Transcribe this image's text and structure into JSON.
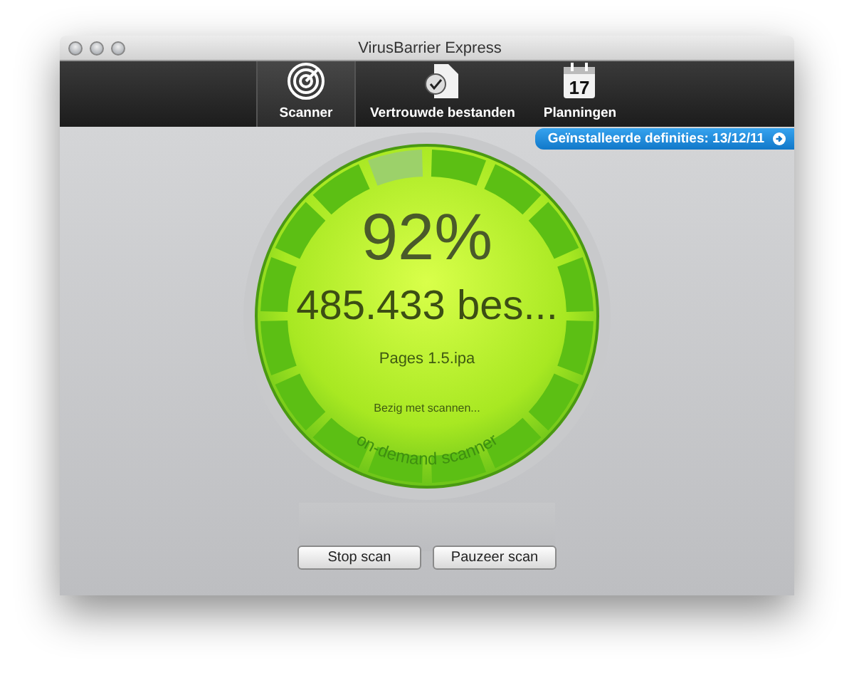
{
  "window": {
    "title": "VirusBarrier Express"
  },
  "toolbar": [
    {
      "label": "Scanner",
      "kind": "radar",
      "selected": true
    },
    {
      "label": "Vertrouwde bestanden",
      "kind": "document",
      "selected": false
    },
    {
      "label": "Planningen",
      "kind": "calendar",
      "selected": false,
      "icon_text": "17"
    }
  ],
  "definitions_badge": "Geïnstalleerde definities: 13/12/11",
  "scan": {
    "percent": "92%",
    "level": 0.92,
    "count": "485.433 bes...",
    "file": "Pages 1.5.ipa",
    "status": "Bezig met scannen...",
    "engine": "on-demand scanner"
  },
  "buttons": [
    "Stop scan",
    "Pauzeer scan"
  ]
}
